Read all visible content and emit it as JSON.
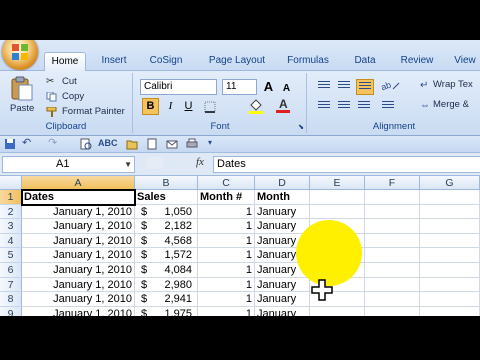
{
  "tabs": [
    "Home",
    "Insert",
    "CoSign",
    "Page Layout",
    "Formulas",
    "Data",
    "Review",
    "View"
  ],
  "active_tab": "Home",
  "clipboard": {
    "paste_label": "Paste",
    "cut_label": "Cut",
    "copy_label": "Copy",
    "format_painter_label": "Format Painter",
    "group_label": "Clipboard"
  },
  "font": {
    "name": "Calibri",
    "size": "11",
    "bold": "B",
    "italic": "I",
    "underline": "U",
    "grow": "A",
    "shrink": "A",
    "font_color": "A",
    "group_label": "Font"
  },
  "alignment": {
    "wrap_text_label": "Wrap Tex",
    "merge_label": "Merge &",
    "group_label": "Alignment"
  },
  "formula_bar": {
    "name_box": "A1",
    "fx": "fx",
    "content": "Dates"
  },
  "columns": [
    "A",
    "B",
    "C",
    "D",
    "E",
    "F",
    "G"
  ],
  "rows": [
    {
      "n": "1",
      "a": "Dates",
      "cur": "",
      "b": "Sales",
      "c": "Month #",
      "d": "Month"
    },
    {
      "n": "2",
      "a": "January 1, 2010",
      "cur": "$",
      "b": "1,050",
      "c": "1",
      "d": "January"
    },
    {
      "n": "3",
      "a": "January 1, 2010",
      "cur": "$",
      "b": "2,182",
      "c": "1",
      "d": "January"
    },
    {
      "n": "4",
      "a": "January 1, 2010",
      "cur": "$",
      "b": "4,568",
      "c": "1",
      "d": "January"
    },
    {
      "n": "5",
      "a": "January 1, 2010",
      "cur": "$",
      "b": "1,572",
      "c": "1",
      "d": "January"
    },
    {
      "n": "6",
      "a": "January 1, 2010",
      "cur": "$",
      "b": "4,084",
      "c": "1",
      "d": "January"
    },
    {
      "n": "7",
      "a": "January 1, 2010",
      "cur": "$",
      "b": "2,980",
      "c": "1",
      "d": "January"
    },
    {
      "n": "8",
      "a": "January 1, 2010",
      "cur": "$",
      "b": "2,941",
      "c": "1",
      "d": "January"
    },
    {
      "n": "9",
      "a": "January 1, 2010",
      "cur": "$",
      "b": "1,975",
      "c": "1",
      "d": "January"
    }
  ],
  "colors": {
    "ribbon": "#c9dbf2",
    "tab_text": "#15428b",
    "highlight": "#fff000",
    "selected_header": "#f1c05c"
  }
}
